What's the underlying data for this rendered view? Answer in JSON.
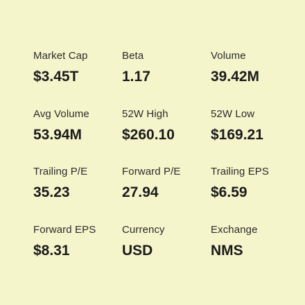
{
  "stats": [
    {
      "key": "market-cap",
      "label": "Market Cap",
      "value": "$3.45T"
    },
    {
      "key": "beta",
      "label": "Beta",
      "value": "1.17"
    },
    {
      "key": "volume",
      "label": "Volume",
      "value": "39.42M"
    },
    {
      "key": "avg-volume",
      "label": "Avg Volume",
      "value": "53.94M"
    },
    {
      "key": "52w-high",
      "label": "52W High",
      "value": "$260.10"
    },
    {
      "key": "52w-low",
      "label": "52W Low",
      "value": "$169.21"
    },
    {
      "key": "trailing-pe",
      "label": "Trailing P/E",
      "value": "35.23"
    },
    {
      "key": "forward-pe",
      "label": "Forward P/E",
      "value": "27.94"
    },
    {
      "key": "trailing-eps",
      "label": "Trailing EPS",
      "value": "$6.59"
    },
    {
      "key": "forward-eps",
      "label": "Forward EPS",
      "value": "$8.31"
    },
    {
      "key": "currency",
      "label": "Currency",
      "value": "USD"
    },
    {
      "key": "exchange",
      "label": "Exchange",
      "value": "NMS"
    }
  ],
  "colors": {
    "background": "#f5f5cc",
    "label": "#2b2b2b",
    "value": "#1a1a1a"
  }
}
